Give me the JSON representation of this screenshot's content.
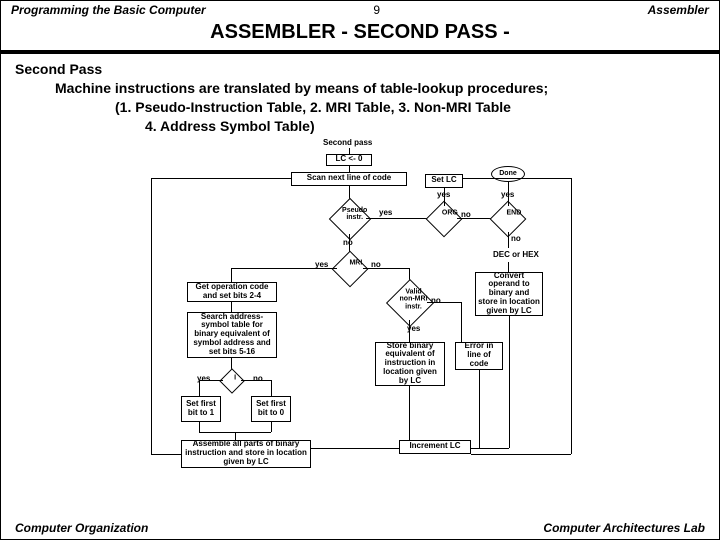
{
  "header": {
    "left": "Programming the Basic Computer",
    "page": "9",
    "right": "Assembler"
  },
  "title": "ASSEMBLER     - SECOND  PASS -",
  "subtitle": {
    "l1": "Second Pass",
    "l2": "Machine instructions are translated  by means of table-lookup procedures;",
    "l3": "(1. Pseudo-Instruction Table, 2. MRI Table, 3. Non-MRI Table",
    "l4": "4. Address Symbol Table)"
  },
  "flow": {
    "start": "Second pass",
    "lc0": "LC <-  0",
    "scan": "Scan next line of code",
    "setlc": "Set LC",
    "done": "Done",
    "pseudo": "Pseudo instr.",
    "org": "ORG",
    "end": "END",
    "mri": "MRI",
    "dechex": "DEC or HEX",
    "getop": "Get operation code and set bits 2-4",
    "search": "Search address-symbol table for binary equivalent of symbol address and set bits 5-16",
    "validnon": "Valid non-MRI instr.",
    "convert": "Convert operand to binary and store in location given by LC",
    "storebin": "Store binary equivalent of instruction in location given by LC",
    "error": "Error in line of code",
    "i": "I",
    "setfirst1": "Set first bit to 1",
    "setfirst0": "Set first bit to 0",
    "assemble": "Assemble all parts of binary instruction and store in location given by LC",
    "inc": "Increment LC",
    "yes": "yes",
    "no": "no"
  },
  "footer": {
    "left": "Computer Organization",
    "right": "Computer Architectures Lab"
  }
}
